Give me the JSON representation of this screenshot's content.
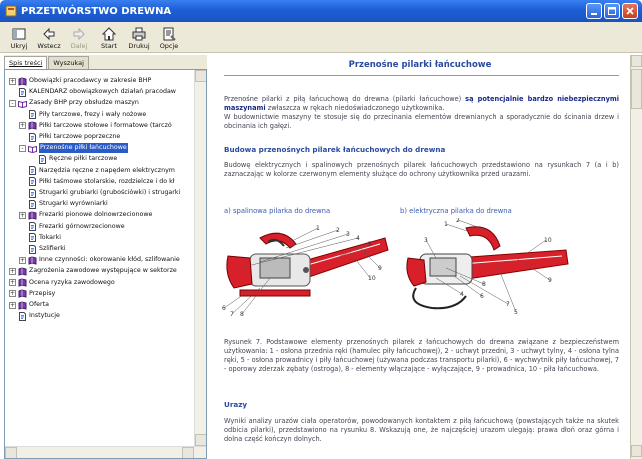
{
  "window": {
    "title": "PRZETWÓRSTWO DREWNA"
  },
  "toolbar": {
    "buttons": [
      {
        "label": "Ukryj",
        "icon": "hide-icon",
        "enabled": true
      },
      {
        "label": "Wstecz",
        "icon": "back-arrow-icon",
        "enabled": true
      },
      {
        "label": "Dalej",
        "icon": "forward-arrow-icon",
        "enabled": false
      },
      {
        "label": "Start",
        "icon": "home-icon",
        "enabled": true
      },
      {
        "label": "Drukuj",
        "icon": "printer-icon",
        "enabled": true
      },
      {
        "label": "Opcje",
        "icon": "options-icon",
        "enabled": true
      }
    ]
  },
  "sidebar": {
    "tabs": [
      "Spis treści",
      "Wyszukaj"
    ],
    "active_tab": "Spis treści",
    "tree": [
      {
        "label": "Obowiązki pracodawcy w zakresie BHP",
        "level": 0,
        "expander": "+",
        "icon": "book-icon"
      },
      {
        "label": "KALENDARZ obowiązkowych działań pracodaw",
        "level": 0,
        "expander": "",
        "icon": "page-icon"
      },
      {
        "label": "Zasady BHP przy obsłudze maszyn",
        "level": 0,
        "expander": "-",
        "icon": "open-book-icon"
      },
      {
        "label": "Piły tarczowe, frezy i wały nożowe",
        "level": 1,
        "expander": "",
        "icon": "page-icon"
      },
      {
        "label": "Piłki tarczowe stołowe i formatowe (tarczó",
        "level": 1,
        "expander": "+",
        "icon": "book-icon"
      },
      {
        "label": "Piłki tarczowe poprzeczne",
        "level": 1,
        "expander": "",
        "icon": "page-icon"
      },
      {
        "label": "Przenośne piłki łańcuchowe",
        "level": 1,
        "expander": "-",
        "icon": "open-book-icon",
        "selected": true
      },
      {
        "label": "Ręczne piłki tarczowe",
        "level": 2,
        "expander": "",
        "icon": "page-icon"
      },
      {
        "label": "Narzędzia ręczne z napędem elektrycznym",
        "level": 1,
        "expander": "",
        "icon": "page-icon"
      },
      {
        "label": "Piłki taśmowe stolarskie, rozdzielcze i do kł",
        "level": 1,
        "expander": "",
        "icon": "page-icon"
      },
      {
        "label": "Strugarki grubiarki (grubościówki) i strugarki ",
        "level": 1,
        "expander": "",
        "icon": "page-icon"
      },
      {
        "label": "Strugarki wyrówniarki",
        "level": 1,
        "expander": "",
        "icon": "page-icon"
      },
      {
        "label": "Frezarki pionowe dolnowrzecionowe",
        "level": 1,
        "expander": "+",
        "icon": "book-icon"
      },
      {
        "label": "Frezarki górnowrzecionowe",
        "level": 1,
        "expander": "",
        "icon": "page-icon"
      },
      {
        "label": "Tokarki",
        "level": 1,
        "expander": "",
        "icon": "page-icon"
      },
      {
        "label": "Szlifierki",
        "level": 1,
        "expander": "",
        "icon": "page-icon"
      },
      {
        "label": "Inne czynności: okorowanie kłód, szlifowanie",
        "level": 1,
        "expander": "+",
        "icon": "book-icon"
      },
      {
        "label": "Zagrożenia zawodowe występujące w sektorze",
        "level": 0,
        "expander": "+",
        "icon": "book-icon"
      },
      {
        "label": "Ocena ryzyka zawodowego",
        "level": 0,
        "expander": "+",
        "icon": "book-icon"
      },
      {
        "label": "Przepisy",
        "level": 0,
        "expander": "+",
        "icon": "book-icon"
      },
      {
        "label": "Oferta",
        "level": 0,
        "expander": "+",
        "icon": "book-icon"
      },
      {
        "label": "Instytucje",
        "level": 0,
        "expander": "",
        "icon": "page-icon"
      }
    ]
  },
  "content": {
    "title": "Przenośne pilarki łańcuchowe",
    "intro_plain": "Przenośne pilarki z piłą łańcuchową do drewna (pilarki łańcuchowe) ",
    "intro_bold": "są potencjalnie bardzo niebezpiecznymi maszynami",
    "intro_rest": " zwłaszcza w rękach niedoświadczonego użytkownika.",
    "intro2": "W budownictwie maszyny te stosuje się do przecinania elementów drewnianych a sporadycznie do ścinania drzew i obcinania ich gałęzi.",
    "section1_heading": "Budowa przenośnych pilarek łańcuchowych do drewna",
    "section1_text": "Budowę elektrycznych i spalinowych przenośnych pilarek łańcuchowych przedstawiono na rysunkach 7 (a i b) zaznaczając w kolorze czerwonym elementy służące do ochrony użytkownika przed urazami.",
    "figure_a_caption": "a) spalinowa pilarka do drewna",
    "figure_b_caption": "b) elektryczna pilarka do drewna",
    "figure_a_numbers": [
      "1",
      "2",
      "3",
      "4",
      "5",
      "6",
      "7",
      "8",
      "9",
      "10"
    ],
    "figure_b_numbers": [
      "1",
      "2",
      "3",
      "4",
      "5",
      "6",
      "7",
      "8",
      "9",
      "10"
    ],
    "figure_text": "Rysunek 7. Podstawowe elementy przenośnych pilarek z łańcuchowych do drewna związane z bezpieczeństwem użytkowania: 1 - osłona przednia ręki (hamulec piły łańcuchowej), 2 - uchwyt przedni, 3 - uchwyt tylny, 4 - osłona tylna ręki, 5 - osłona prowadnicy i piły łańcuchowej (używana podczas transportu pilarki), 6 - wychwytnik piły łańcuchowej, 7 - oporowy zderzak zębaty (ostroga), 8 - elementy włączające - wyłączające, 9 - prowadnica, 10 - piła łańcuchowa.",
    "section2_heading": "Urazy",
    "section2_text": "Wyniki analizy urazów ciała operatorów, powodowanych kontaktem z piłą łańcuchową (powstających także na skutek odbicia pilarki), przedstawiono na rysunku 8. Wskazują one, że najczęściej urazom ulegają: prawa dłoń oraz górna i dolna część kończyn dolnych."
  },
  "colors": {
    "title_blue": "#2a4aa0",
    "saw_red": "#d8202a",
    "selection": "#2b5bc7"
  }
}
